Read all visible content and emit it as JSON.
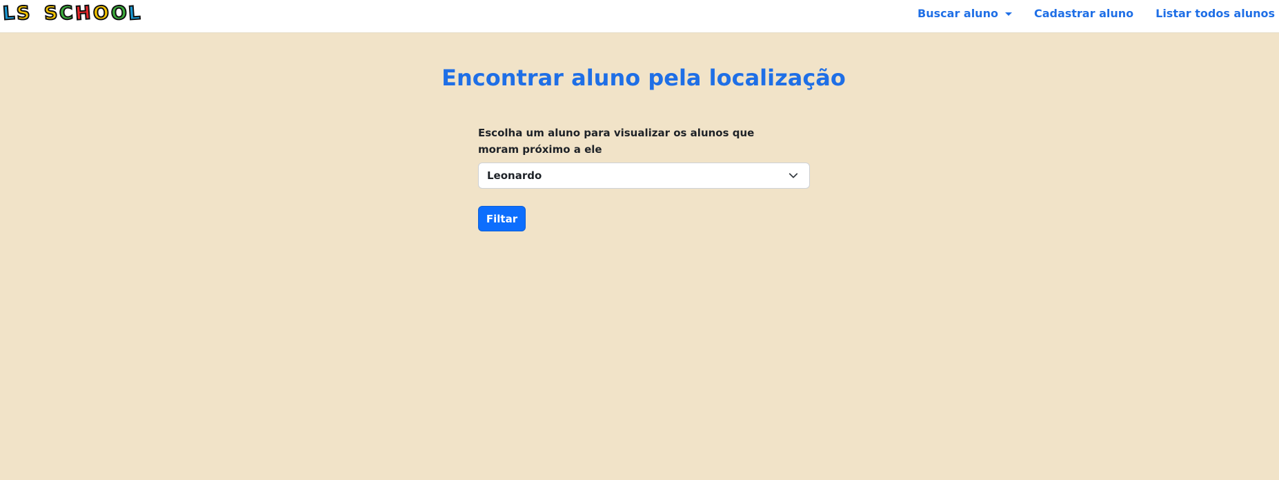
{
  "brand": {
    "letters": [
      {
        "char": "L",
        "color": "#1a9ad6"
      },
      {
        "char": "S",
        "color": "#f5c400"
      },
      {
        "char": " ",
        "color": ""
      },
      {
        "char": "S",
        "color": "#f5c400"
      },
      {
        "char": "C",
        "color": "#3cae3c"
      },
      {
        "char": "H",
        "color": "#e8282b"
      },
      {
        "char": "O",
        "color": "#f5c400"
      },
      {
        "char": "O",
        "color": "#3cae3c"
      },
      {
        "char": "L",
        "color": "#1a9ad6"
      }
    ],
    "text": "LS SCHOOL"
  },
  "nav": {
    "buscar_label": "Buscar aluno",
    "cadastrar_label": "Cadastrar aluno",
    "listar_label": "Listar todos alunos"
  },
  "main": {
    "title": "Encontrar aluno pela localização",
    "select_label": "Escolha um aluno para visualizar os alunos que moram próximo a ele",
    "selected_value": "Leonardo",
    "filter_button_label": "Filtar"
  },
  "colors": {
    "accent": "#1f6fe6",
    "button": "#0d6efd",
    "background": "#f1e3c8"
  }
}
